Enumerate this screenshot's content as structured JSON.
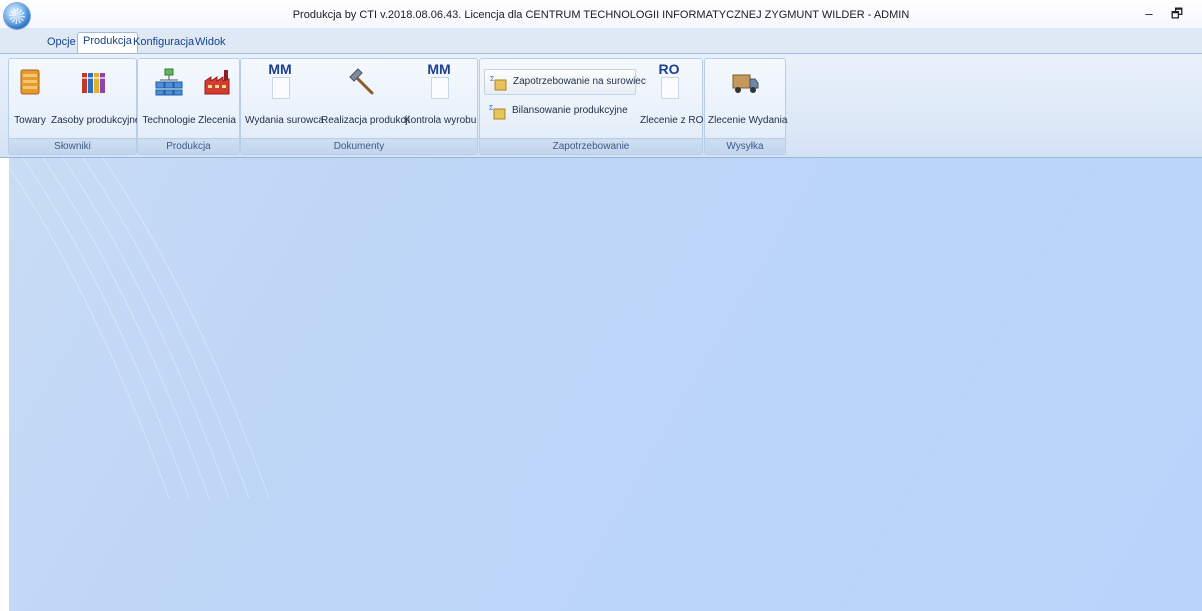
{
  "window": {
    "title": "Produkcja by CTI v.2018.08.06.43. Licencja dla CENTRUM TECHNOLOGII INFORMATYCZNEJ ZYGMUNT WILDER - ADMIN",
    "minimize_glyph": "–",
    "restore_glyph": "🗗"
  },
  "tabs": [
    {
      "label": "Opcje"
    },
    {
      "label": "Produkcja",
      "active": true
    },
    {
      "label": "Konfiguracja"
    },
    {
      "label": "Widok"
    }
  ],
  "ribbon": {
    "groups": {
      "slowniki": {
        "label": "Słowniki",
        "buttons": [
          {
            "label": "Towary",
            "icon": "box-icon"
          },
          {
            "label": "Zasoby produkcyjne",
            "icon": "binders-icon"
          }
        ]
      },
      "produkcja": {
        "label": "Produkcja",
        "buttons": [
          {
            "label": "Technologie",
            "icon": "hierarchy-icon"
          },
          {
            "label": "Zlecenia",
            "icon": "factory-icon"
          }
        ]
      },
      "dokumenty": {
        "label": "Dokumenty",
        "buttons": [
          {
            "label": "Wydania surowca",
            "icon": "mm-document-icon",
            "badge": "MM"
          },
          {
            "label": "Realizacja produkcji",
            "icon": "hammer-icon"
          },
          {
            "label": "Kontrola wyrobu",
            "icon": "mm-document-icon",
            "badge": "MM"
          }
        ]
      },
      "zapotrzebowanie": {
        "label": "Zapotrzebowanie",
        "small_buttons": [
          {
            "label": "Zapotrzebowanie na surowiec",
            "icon": "calculation-icon"
          },
          {
            "label": "Bilansowanie produkcyjne",
            "icon": "calculation-icon"
          }
        ],
        "buttons": [
          {
            "label": "Zlecenie z RO",
            "icon": "ro-document-icon",
            "badge": "RO"
          }
        ]
      },
      "wysylka": {
        "label": "Wysyłka",
        "buttons": [
          {
            "label": "Zlecenie Wydania",
            "icon": "truck-icon"
          }
        ]
      }
    }
  },
  "colors": {
    "workspace": "#bbd5f9",
    "ribbon": "#dce8f6",
    "accent": "#15428b"
  }
}
